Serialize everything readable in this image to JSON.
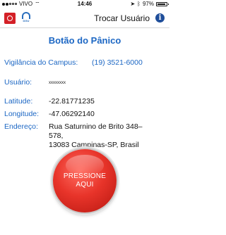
{
  "status_bar": {
    "carrier": "VIVO",
    "time": "14:46",
    "battery": "97%"
  },
  "nav": {
    "title": "Trocar Usuário",
    "info_icon": "info-icon"
  },
  "page": {
    "title": "Botão do Pânico"
  },
  "details": {
    "vigilancia_label": "Vigilância do Campus:",
    "vigilancia_phone": "(19) 3521-6000",
    "usuario_label": "Usuário:",
    "usuario_value": "xxxxxxxx",
    "latitude_label": "Latitude:",
    "latitude_value": "-22.81771235",
    "longitude_label": "Longitude:",
    "longitude_value": "-47.06292140",
    "endereco_label": "Endereço:",
    "endereco_line1": "Rua Saturnino de Brito 348–578,",
    "endereco_line2": "13083 Campinas-SP, Brasil"
  },
  "panic_button": {
    "line1": "PRESSIONE",
    "line2": "AQUI"
  },
  "colors": {
    "accent": "#1c67c4",
    "panic_red": "#e8342a"
  }
}
